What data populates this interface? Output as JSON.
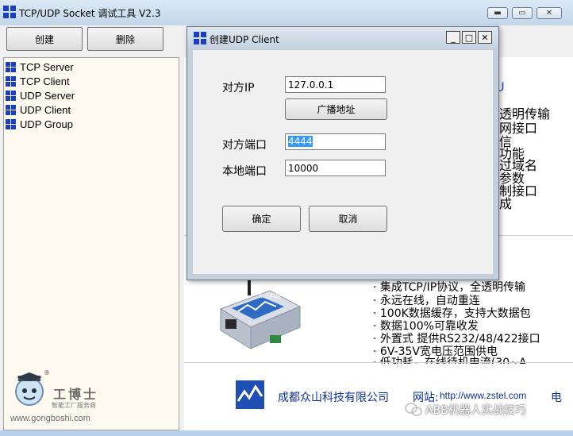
{
  "window": {
    "title": "TCP/UDP Socket 调试工具 V2.3"
  },
  "toolbar": {
    "create_label": "创建",
    "delete_label": "删除"
  },
  "tree": {
    "items": [
      {
        "label": "TCP Server"
      },
      {
        "label": "TCP Client"
      },
      {
        "label": "UDP Server"
      },
      {
        "label": "UDP Client"
      },
      {
        "label": "UDP Group"
      }
    ]
  },
  "background_panel": {
    "partial_lines": [
      "U",
      "透明传输",
      "网接口",
      "信",
      "功能",
      "过域名",
      "参数",
      "制接口",
      "成"
    ],
    "features": [
      "· 集成TCP/IP协议，全透明传输",
      "· 永远在线，自动重连",
      "· 100K数据缓存，支持大数据包",
      "· 数据100%可靠收发",
      "· 外置式 提供RS232/48/422接口",
      "· 6V-35V宽电压范围供电",
      "· 低功耗，在线待机电流(30~A"
    ],
    "company": "成都众山科技有限公司",
    "website_label": "网站:",
    "website": "http://www.zstel.com",
    "phone_prefix": "电",
    "device_brand": "众山科技",
    "watermark": "ABB机器人实战技巧"
  },
  "logo": {
    "name": "工博士",
    "slogan": "智能工厂服务商",
    "url": "www.gongboshi.com",
    "registered": "®"
  },
  "dialog": {
    "title": "创建UDP Client",
    "peer_ip_label": "对方IP",
    "peer_ip_value": "127.0.0.1",
    "broadcast_label": "广播地址",
    "peer_port_label": "对方端口",
    "peer_port_value": "4444",
    "local_port_label": "本地端口",
    "local_port_value": "10000",
    "ok_label": "确定",
    "cancel_label": "取消",
    "minimize_symbol": "_",
    "maximize_symbol": "□",
    "close_symbol": "✕"
  },
  "colors": {
    "title_bar": "#c3d7ea",
    "tree_bg": "#fffaf0",
    "dialog_frame": "#c4cfdc",
    "selection": "#3399ff",
    "company_text": "#0a2f9e",
    "watermark": "#ffffff"
  }
}
